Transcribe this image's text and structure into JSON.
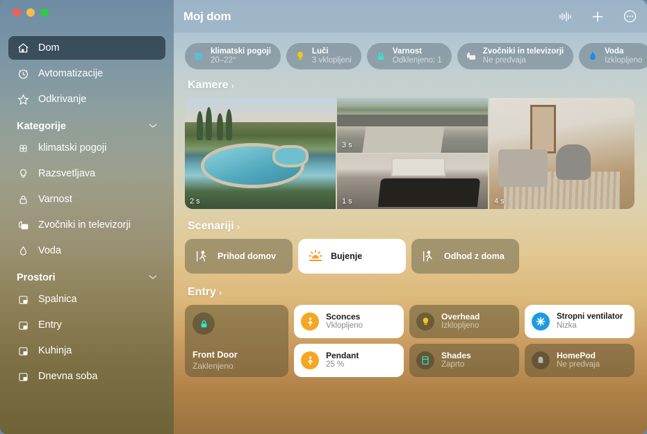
{
  "window": {
    "traffic_lights": [
      "close",
      "minimize",
      "zoom"
    ]
  },
  "sidebar": {
    "top_items": [
      {
        "label": "Dom",
        "icon": "home-icon",
        "active": true
      },
      {
        "label": "Avtomatizacije",
        "icon": "clock-icon",
        "active": false
      },
      {
        "label": "Odkrivanje",
        "icon": "star-icon",
        "active": false
      }
    ],
    "categories": {
      "title": "Kategorije",
      "chevron": "chevron-down-icon",
      "items": [
        {
          "label": "klimatski pogoji",
          "icon": "fan-icon"
        },
        {
          "label": "Razsvetljava",
          "icon": "bulb-icon"
        },
        {
          "label": "Varnost",
          "icon": "lock-icon"
        },
        {
          "label": "Zvočniki in televizorji",
          "icon": "speaker-tv-icon"
        },
        {
          "label": "Voda",
          "icon": "water-drop-icon"
        }
      ]
    },
    "rooms": {
      "title": "Prostori",
      "chevron": "chevron-down-icon",
      "items": [
        {
          "label": "Spalnica",
          "icon": "room-icon"
        },
        {
          "label": "Entry",
          "icon": "room-icon"
        },
        {
          "label": "Kuhinja",
          "icon": "room-icon"
        },
        {
          "label": "Dnevna soba",
          "icon": "room-icon"
        }
      ]
    }
  },
  "toolbar": {
    "title": "Moj dom",
    "actions": [
      {
        "name": "audio-waveform-icon"
      },
      {
        "name": "plus-icon"
      },
      {
        "name": "more-options-icon"
      }
    ]
  },
  "status_pills": [
    {
      "name": "klimatski pogoji",
      "value": "20–22°",
      "icon": "fan-icon",
      "color": "#4ec3e0"
    },
    {
      "name": "Luči",
      "value": "3 vklopljeni",
      "icon": "bulb-icon",
      "color": "#f5c518"
    },
    {
      "name": "Varnost",
      "value": "Odklenjeno: 1",
      "icon": "lock-icon",
      "color": "#3ee0c8"
    },
    {
      "name": "Zvočniki in televizorji",
      "value": "Ne predvaja",
      "icon": "speaker-tv-icon",
      "color": "#ffffff"
    },
    {
      "name": "Voda",
      "value": "Izklopljeno",
      "icon": "water-drop-icon",
      "color": "#1b8cf0"
    }
  ],
  "cameras": {
    "section_title": "Kamere",
    "arrow": "chevron-right-icon",
    "feeds": [
      {
        "name": "pool-camera",
        "timestamp": "2 s"
      },
      {
        "name": "driveway-camera",
        "timestamp": "3 s"
      },
      {
        "name": "bedroom-camera",
        "timestamp": "1 s"
      },
      {
        "name": "living-room-camera",
        "timestamp": "4 s"
      }
    ]
  },
  "scenes": {
    "section_title": "Scenariji",
    "arrow": "chevron-right-icon",
    "items": [
      {
        "label": "Prihod domov",
        "icon": "walk-in-icon",
        "active": false
      },
      {
        "label": "Bujenje",
        "icon": "sunrise-icon",
        "active": true
      },
      {
        "label": "Odhod z doma",
        "icon": "walk-out-icon",
        "active": false
      }
    ]
  },
  "entry": {
    "section_title": "Entry",
    "arrow": "chevron-right-icon",
    "door": {
      "name": "Front Door",
      "state": "Zaklenjeno",
      "icon": "lock-icon"
    },
    "accessories": [
      {
        "name": "Sconces",
        "state": "Vklopljeno",
        "icon": "sconce-light-icon",
        "on": true
      },
      {
        "name": "Pendant",
        "state": "25 %",
        "icon": "pendant-light-icon",
        "on": true
      },
      {
        "name": "Overhead",
        "state": "Izklopljeno",
        "icon": "bulb-icon",
        "on": false
      },
      {
        "name": "Shades",
        "state": "Zaprto",
        "icon": "shades-icon",
        "on": false
      },
      {
        "name": "Stropni ventilator",
        "state": "Nizka",
        "icon": "fan-icon",
        "on": true
      },
      {
        "name": "HomePod",
        "state": "Ne predvaja",
        "icon": "homepod-icon",
        "on": false
      }
    ]
  }
}
